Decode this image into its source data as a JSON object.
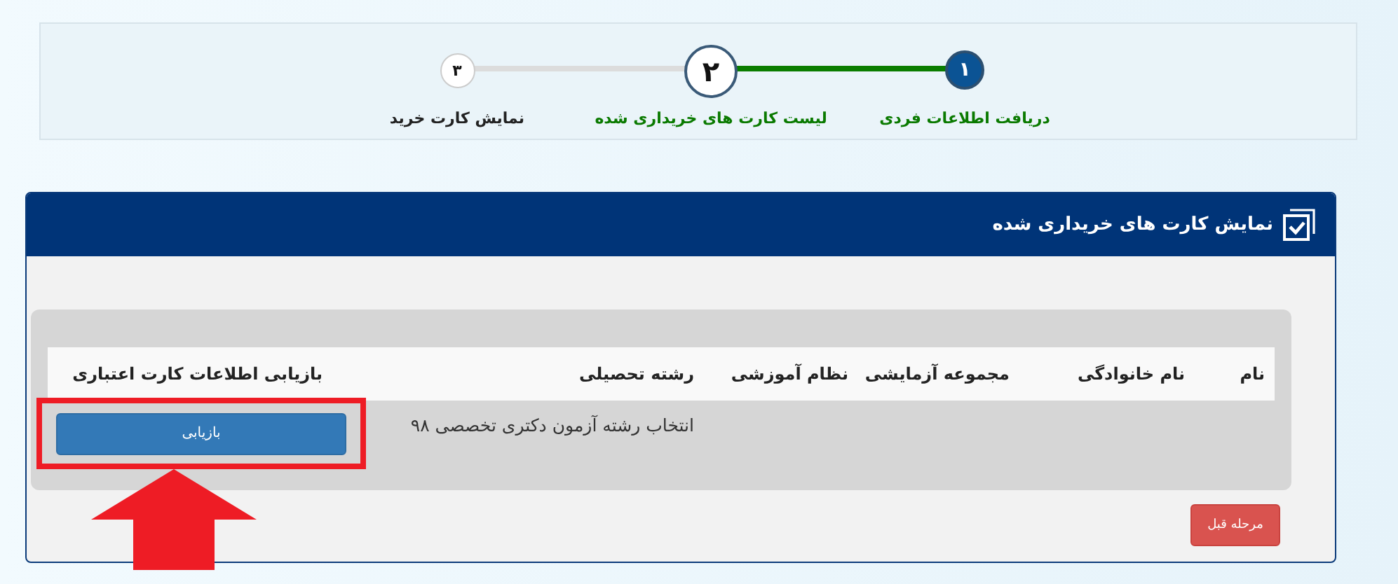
{
  "stepper": {
    "steps": [
      {
        "number": "۱",
        "label": "دریافت اطلاعات فردی",
        "completed": true,
        "selected": false
      },
      {
        "number": "۲",
        "label": "لیست کارت های خریداری شده",
        "completed": false,
        "selected": true
      },
      {
        "number": "۳",
        "label": "نمایش  کارت خرید",
        "completed": false,
        "selected": false
      }
    ]
  },
  "panel": {
    "title": "نمایش کارت های خریداری شده",
    "table": {
      "columns": [
        "نام",
        "نام خانوادگی",
        "مجموعه آزمایشی",
        "نظام آموزشی",
        "رشته تحصیلی",
        "بازیابی اطلاعات کارت اعتباری"
      ],
      "rows": [
        {
          "field_of_study": "انتخاب رشته آزمون دکتری تخصصی ۹۸",
          "action": "بازیابی",
          "highlighted": true
        }
      ]
    },
    "back_button": "مرحله قبل"
  }
}
